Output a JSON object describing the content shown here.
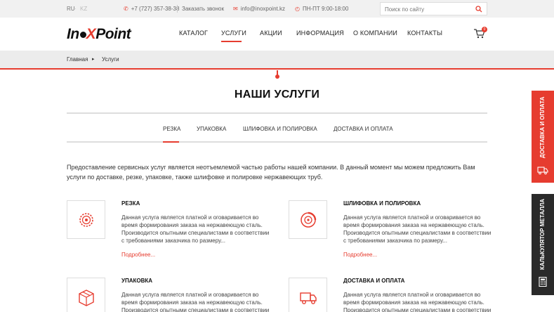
{
  "topbar": {
    "lang_ru": "RU",
    "lang_sep": "·",
    "lang_kz": "KZ",
    "phone": "+7 (727) 357-38-38",
    "callback": "Заказать звонок",
    "email": "info@inoxpoint.kz",
    "hours": "ПН-ПТ  9:00-18:00",
    "search_placeholder": "Поиск по сайту"
  },
  "logo": {
    "part1": "In",
    "part2": "X",
    "part3": "Point"
  },
  "nav": {
    "items": [
      "Каталог",
      "Услуги",
      "Акции",
      "Информация",
      "О компании",
      "Контакты"
    ],
    "active": "Услуги"
  },
  "cart": {
    "count": "0"
  },
  "breadcrumb": {
    "home": "Главная",
    "current": "Услуги"
  },
  "page": {
    "title": "НАШИ УСЛУГИ"
  },
  "tabs": {
    "items": [
      "Резка",
      "Упаковка",
      "Шлифовка и полировка",
      "Доставка и оплата"
    ],
    "active": "Резка"
  },
  "intro": "Предоставление сервисных услуг является неотъемлемой частью работы нашей компании. В данный момент мы можем предложить Вам услуги по доставке, резке, упаковке, также шлифовке и полировке нержавеющих труб.",
  "services": [
    {
      "title": "Резка",
      "icon": "saw-blade-icon",
      "desc": "Данная услуга является платной и оговаривается во время формирования заказа на нержавеющую сталь. Производится опытными специалистами в соответствии с требованиями заказчика по размеру...",
      "more": "Подробнее..."
    },
    {
      "title": "Шлифовка и полировка",
      "icon": "polishing-disc-icon",
      "desc": "Данная услуга является платной и оговаривается во время формирования заказа на нержавеющую сталь. Производится опытными специалистами в соответствии с требованиями заказчика по размеру...",
      "more": "Подробнее..."
    },
    {
      "title": "Упаковка",
      "icon": "box-icon",
      "desc": "Данная услуга является платной и оговаривается во время формирования заказа на нержавеющую сталь. Производится опытными специалистами в соответствии с",
      "more": ""
    },
    {
      "title": "Доставка и оплата",
      "icon": "truck-icon",
      "desc": "Данная услуга является платной и оговаривается во время формирования заказа на нержавеющую сталь. Производится опытными специалистами в соответствии с",
      "more": ""
    }
  ],
  "side": {
    "delivery": "Доставка и оплата",
    "calculator": "Калькулятор металла"
  },
  "colors": {
    "accent": "#e63c2f",
    "dark": "#2a2a2a",
    "strip": "#ececec"
  }
}
